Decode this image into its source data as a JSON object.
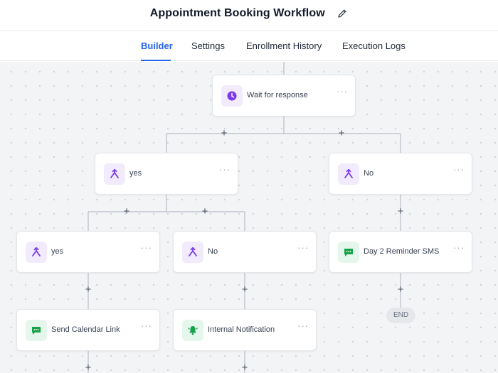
{
  "header": {
    "title": "Appointment Booking Workflow"
  },
  "tabs": [
    {
      "label": "Builder",
      "active": true
    },
    {
      "label": "Settings",
      "active": false
    },
    {
      "label": "Enrollment History",
      "active": false
    },
    {
      "label": "Execution Logs",
      "active": false
    }
  ],
  "nodes": {
    "wait": {
      "label": "Wait for response",
      "icon": "clock-icon"
    },
    "branch_yes": {
      "label": "yes",
      "icon": "branch-icon"
    },
    "branch_no": {
      "label": "No",
      "icon": "branch-icon"
    },
    "sub_yes": {
      "label": "yes",
      "icon": "branch-icon"
    },
    "sub_no": {
      "label": "No",
      "icon": "branch-icon"
    },
    "sms": {
      "label": "Day 2 Reminder SMS",
      "icon": "chat-icon"
    },
    "calendar": {
      "label": "Send Calendar Link",
      "icon": "chat-icon"
    },
    "notify": {
      "label": "Internal Notification",
      "icon": "bell-icon"
    }
  },
  "more_glyph": "···",
  "plus_glyph": "+",
  "end_label": "END",
  "colors": {
    "accent": "#2563eb",
    "purple": "#7c3aed",
    "green": "#16a34a"
  }
}
